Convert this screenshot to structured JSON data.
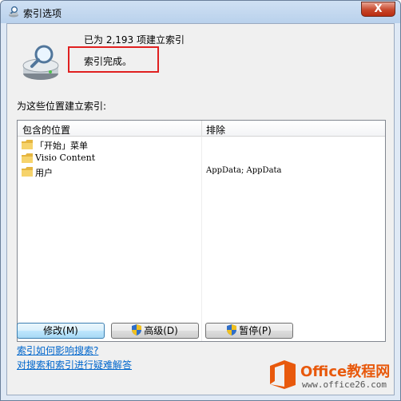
{
  "window": {
    "title": "索引选项",
    "close_label": "X"
  },
  "summary": {
    "count_text": "已为 2,193 项建立索引",
    "status_text": "索引完成。"
  },
  "locations": {
    "label": "为这些位置建立索引:",
    "columns": {
      "included": "包含的位置",
      "excluded": "排除"
    },
    "rows": [
      {
        "name": "「开始」菜单",
        "excluded": ""
      },
      {
        "name": "Visio Content",
        "excluded": ""
      },
      {
        "name": "用户",
        "excluded": "AppData; AppData"
      }
    ]
  },
  "buttons": {
    "modify": "修改(M)",
    "advanced": "高级(D)",
    "pause": "暂停(P)"
  },
  "links": {
    "how_affects": "索引如何影响搜索?",
    "troubleshoot": "对搜索和索引进行疑难解答"
  },
  "watermark": {
    "title": "Office教程网",
    "url": "www.office26.com"
  },
  "colors": {
    "highlight_box": "#e02020",
    "link": "#0066cc",
    "watermark_orange": "#e8590c"
  }
}
